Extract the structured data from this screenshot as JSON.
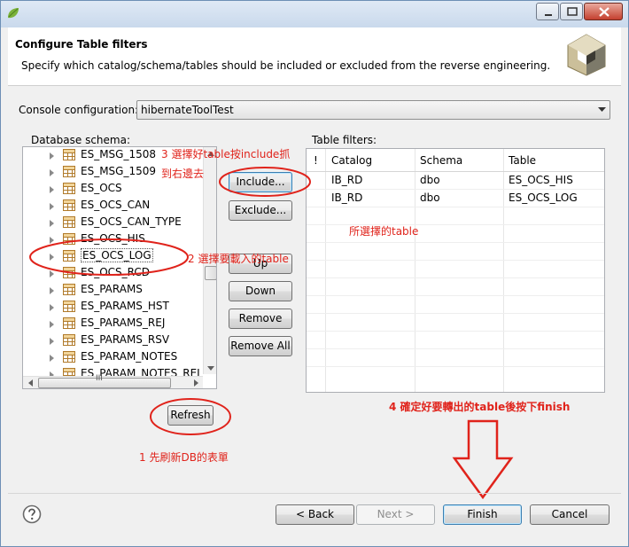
{
  "window": {
    "title_controls": [
      "minimize-button",
      "maximize-button",
      "close-button"
    ]
  },
  "header": {
    "title": "Configure Table filters",
    "description": "Specify which catalog/schema/tables should be included or excluded from the reverse engineering."
  },
  "console": {
    "label": "Console configuration:",
    "value": "hibernateToolTest"
  },
  "schema": {
    "label": "Database schema:",
    "items": [
      {
        "label": "ES_MSG_1508"
      },
      {
        "label": "ES_MSG_1509"
      },
      {
        "label": "ES_OCS"
      },
      {
        "label": "ES_OCS_CAN"
      },
      {
        "label": "ES_OCS_CAN_TYPE"
      },
      {
        "label": "ES_OCS_HIS"
      },
      {
        "label": "ES_OCS_LOG"
      },
      {
        "label": "ES_OCS_RCD"
      },
      {
        "label": "ES_PARAMS"
      },
      {
        "label": "ES_PARAMS_HST"
      },
      {
        "label": "ES_PARAMS_REJ"
      },
      {
        "label": "ES_PARAMS_RSV"
      },
      {
        "label": "ES_PARAM_NOTES"
      },
      {
        "label": "ES_PARAM_NOTES_REJ"
      }
    ],
    "hscroll_marker": "III"
  },
  "buttons": {
    "include": "Include...",
    "exclude": "Exclude...",
    "up": "Up",
    "down": "Down",
    "remove": "Remove",
    "remove_all": "Remove All",
    "refresh": "Refresh"
  },
  "filters": {
    "label": "Table filters:",
    "columns": [
      "!",
      "Catalog",
      "Schema",
      "Table"
    ],
    "rows": [
      {
        "catalog": "IB_RD",
        "schema": "dbo",
        "table": "ES_OCS_HIS"
      },
      {
        "catalog": "IB_RD",
        "schema": "dbo",
        "table": "ES_OCS_LOG"
      }
    ]
  },
  "annotations": {
    "step3_line1": "3 選擇好table按include抓",
    "step3_line2": "到右邊去",
    "step2": "2 選擇要載入的table",
    "selected": "所選擇的table",
    "step1": "1 先刷新DB的表單",
    "step4": "4  確定好要轉出的table後按下finish",
    "color": "#e0231b"
  },
  "footer": {
    "back": "< Back",
    "next": "Next >",
    "finish": "Finish",
    "cancel": "Cancel"
  }
}
